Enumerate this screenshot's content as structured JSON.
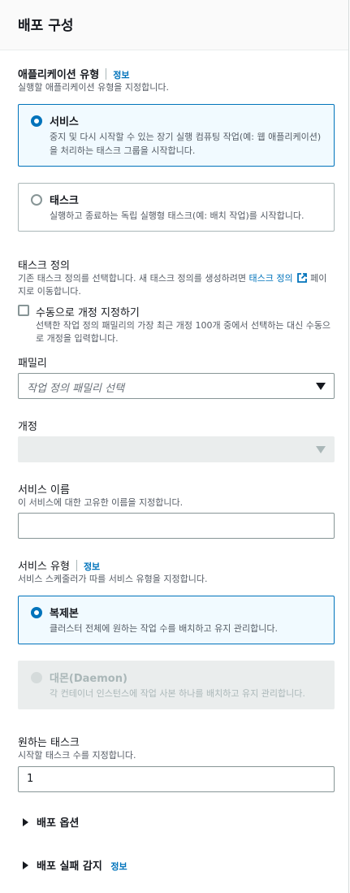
{
  "panel": {
    "title": "배포 구성"
  },
  "app_type": {
    "label": "애플리케이션 유형",
    "info": "정보",
    "description": "실행할 애플리케이션 유형을 지정합니다.",
    "options": [
      {
        "title": "서비스",
        "description": "중지 및 다시 시작할 수 있는 장기 실행 컴퓨팅 작업(예: 웹 애플리케이션)을 처리하는 태스크 그룹을 시작합니다.",
        "selected": true
      },
      {
        "title": "태스크",
        "description": "실행하고 종료하는 독립 실행형 태스크(예: 배치 작업)를 시작합니다.",
        "selected": false
      }
    ]
  },
  "task_def": {
    "label": "태스크 정의",
    "desc_before": "기존 태스크 정의를 선택합니다. 새 태스크 정의를 생성하려면 ",
    "link_text": "태스크 정의",
    "desc_after": " 페이지로 이동합니다.",
    "manual_checkbox_label": "수동으로 개정 지정하기",
    "manual_checkbox_desc": "선택한 작업 정의 패밀리의 가장 최근 개정 100개 중에서 선택하는 대신 수동으로 개정을 입력합니다."
  },
  "family": {
    "label": "패밀리",
    "placeholder": "작업 정의 패밀리 선택"
  },
  "revision": {
    "label": "개정"
  },
  "service_name": {
    "label": "서비스 이름",
    "description": "이 서비스에 대한 고유한 이름을 지정합니다.",
    "value": ""
  },
  "service_type": {
    "label": "서비스 유형",
    "info": "정보",
    "description": "서비스 스케줄러가 따를 서비스 유형을 지정합니다.",
    "options": [
      {
        "title": "복제본",
        "description": "클러스터 전체에 원하는 작업 수를 배치하고 유지 관리합니다.",
        "selected": true,
        "disabled": false
      },
      {
        "title": "대몬(Daemon)",
        "description": "각 컨테이너 인스턴스에 작업 사본 하나를 배치하고 유지 관리합니다.",
        "selected": false,
        "disabled": true
      }
    ]
  },
  "desired_tasks": {
    "label": "원하는 태스크",
    "description": "시작할 태스크 수를 지정합니다.",
    "value": "1"
  },
  "expanders": {
    "deploy_options": "배포 옵션",
    "failure_detection": "배포 실패 감지",
    "failure_detection_info": "정보"
  },
  "colors": {
    "accent": "#0073bb",
    "selected_bg": "#f1faff",
    "disabled_bg": "#eaeded"
  }
}
